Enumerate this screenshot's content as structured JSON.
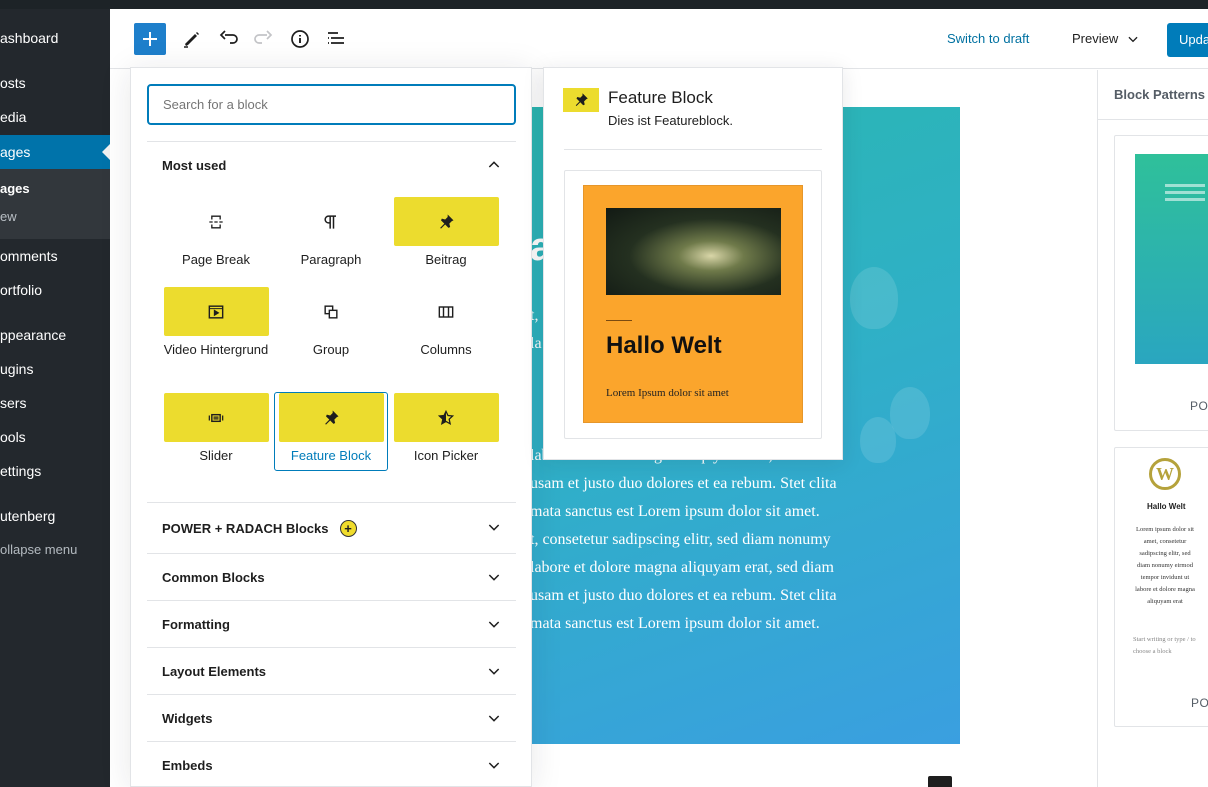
{
  "admin_menu": {
    "items": [
      {
        "label": "ashboard"
      },
      {
        "label": "osts"
      },
      {
        "label": "edia"
      },
      {
        "label": "ages"
      },
      {
        "label": "omments"
      },
      {
        "label": "ortfolio"
      },
      {
        "label": "ppearance"
      },
      {
        "label": "ugins"
      },
      {
        "label": "sers"
      },
      {
        "label": "ools"
      },
      {
        "label": "ettings"
      },
      {
        "label": "utenberg"
      }
    ],
    "submenu": [
      "ages",
      "ew"
    ],
    "collapse_label": "ollapse menu"
  },
  "header": {
    "switch_to_draft": "Switch to draft",
    "preview": "Preview",
    "update": "Upda"
  },
  "inserter": {
    "search_placeholder": "Search for a block",
    "most_used": {
      "title": "Most used",
      "blocks": [
        {
          "label": "Page Break",
          "icon": "page-break-icon",
          "highlight": false
        },
        {
          "label": "Paragraph",
          "icon": "paragraph-icon",
          "highlight": false
        },
        {
          "label": "Beitrag",
          "icon": "pin-icon",
          "highlight": true
        },
        {
          "label": "Video Hintergrund",
          "icon": "video-icon",
          "highlight": true
        },
        {
          "label": "Group",
          "icon": "group-icon",
          "highlight": false
        },
        {
          "label": "Columns",
          "icon": "columns-icon",
          "highlight": false
        },
        {
          "label": "Slider",
          "icon": "slider-icon",
          "highlight": true
        },
        {
          "label": "Feature Block",
          "icon": "pin-icon",
          "highlight": true,
          "selected": true
        },
        {
          "label": "Icon Picker",
          "icon": "star-icon",
          "highlight": true
        }
      ]
    },
    "categories": [
      {
        "label": "POWER + RADACH Blocks",
        "badge": "+"
      },
      {
        "label": "Common Blocks"
      },
      {
        "label": "Formatting"
      },
      {
        "label": "Layout Elements"
      },
      {
        "label": "Widgets"
      },
      {
        "label": "Embeds"
      }
    ]
  },
  "block_preview": {
    "title": "Feature Block",
    "description": "Dies ist Featureblock.",
    "card_heading": "Hallo Welt",
    "card_text": "Lorem Ipsum dolor sit amet"
  },
  "canvas": {
    "title_fragment": "a",
    "lines": [
      "t,",
      "la",
      "",
      "",
      "",
      "labore et dolore magna aliquyam erat, sed diam",
      "usam et justo duo dolores et ea rebum. Stet clita",
      "mata sanctus est Lorem ipsum dolor sit amet.",
      "t, consetetur sadipscing elitr, sed diam nonumy",
      "labore et dolore magna aliquyam erat, sed diam",
      "usam et justo duo dolores et ea rebum. Stet clita",
      "mata sanctus est Lorem ipsum dolor sit amet."
    ]
  },
  "patterns": {
    "title": "Block Patterns",
    "cards": [
      {
        "label": "POW"
      },
      {
        "label": "PO",
        "mini_title": "Hallo Welt",
        "mini_text": "Lorem ipsum dolor sit amet, consetetur sadipscing elitr, sed diam nonumy eirmod tempor invidunt ut labore et dolore magna aliquyam erat",
        "mini_hint": "Start writing or type / to choose a block"
      }
    ]
  },
  "colors": {
    "accent": "#007cba",
    "block_highlight": "#ecdc2e",
    "sidebar": "#23282d",
    "sidebar_current": "#0073aa",
    "card_orange": "#fba52c"
  }
}
